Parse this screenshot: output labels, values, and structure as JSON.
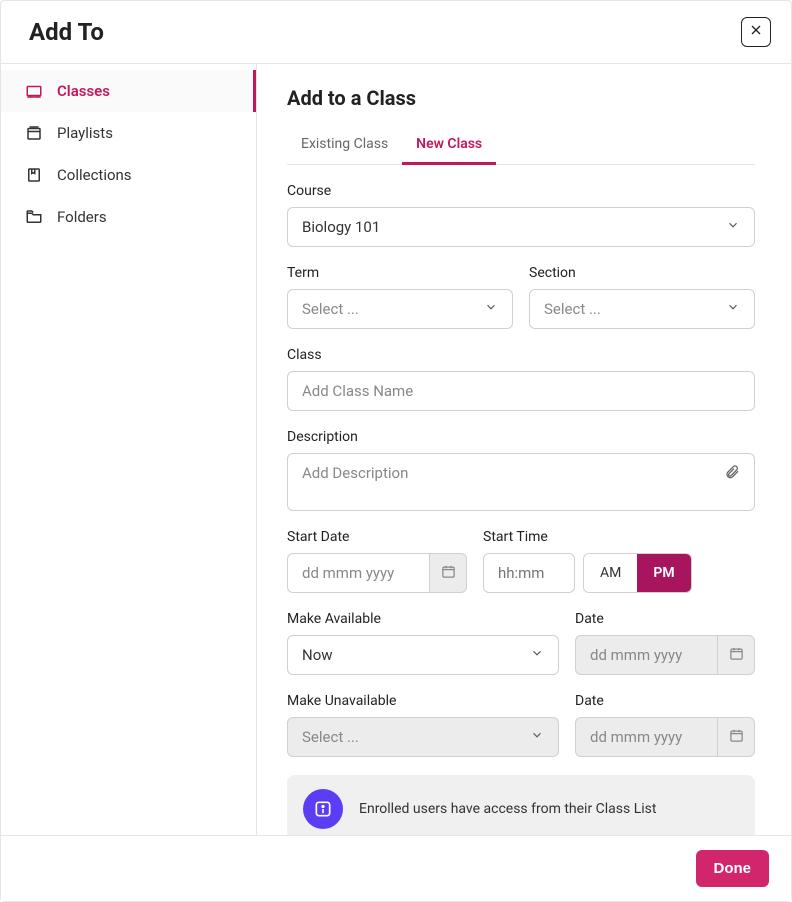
{
  "header": {
    "title": "Add To"
  },
  "sidebar": {
    "items": [
      {
        "label": "Classes"
      },
      {
        "label": "Playlists"
      },
      {
        "label": "Collections"
      },
      {
        "label": "Folders"
      }
    ]
  },
  "main": {
    "heading": "Add to a Class",
    "tabs": [
      {
        "label": "Existing Class"
      },
      {
        "label": "New Class"
      }
    ],
    "course": {
      "label": "Course",
      "value": "Biology 101"
    },
    "termSection": {
      "term": {
        "label": "Term",
        "placeholder": "Select ..."
      },
      "section": {
        "label": "Section",
        "placeholder": "Select ..."
      }
    },
    "class": {
      "label": "Class",
      "placeholder": "Add Class Name"
    },
    "description": {
      "label": "Description",
      "placeholder": "Add Description"
    },
    "startDate": {
      "label": "Start Date",
      "placeholder": "dd mmm yyyy"
    },
    "startTime": {
      "label": "Start Time",
      "placeholder": "hh:mm",
      "am": "AM",
      "pm": "PM"
    },
    "makeAvailable": {
      "label": "Make Available",
      "value": "Now"
    },
    "availDate": {
      "label": "Date",
      "placeholder": "dd mmm yyyy"
    },
    "makeUnavailable": {
      "label": "Make Unavailable",
      "placeholder": "Select ..."
    },
    "unavailDate": {
      "label": "Date",
      "placeholder": "dd mmm yyyy"
    },
    "info": {
      "text": "Enrolled users have access from their Class List"
    }
  },
  "footer": {
    "done": "Done"
  }
}
